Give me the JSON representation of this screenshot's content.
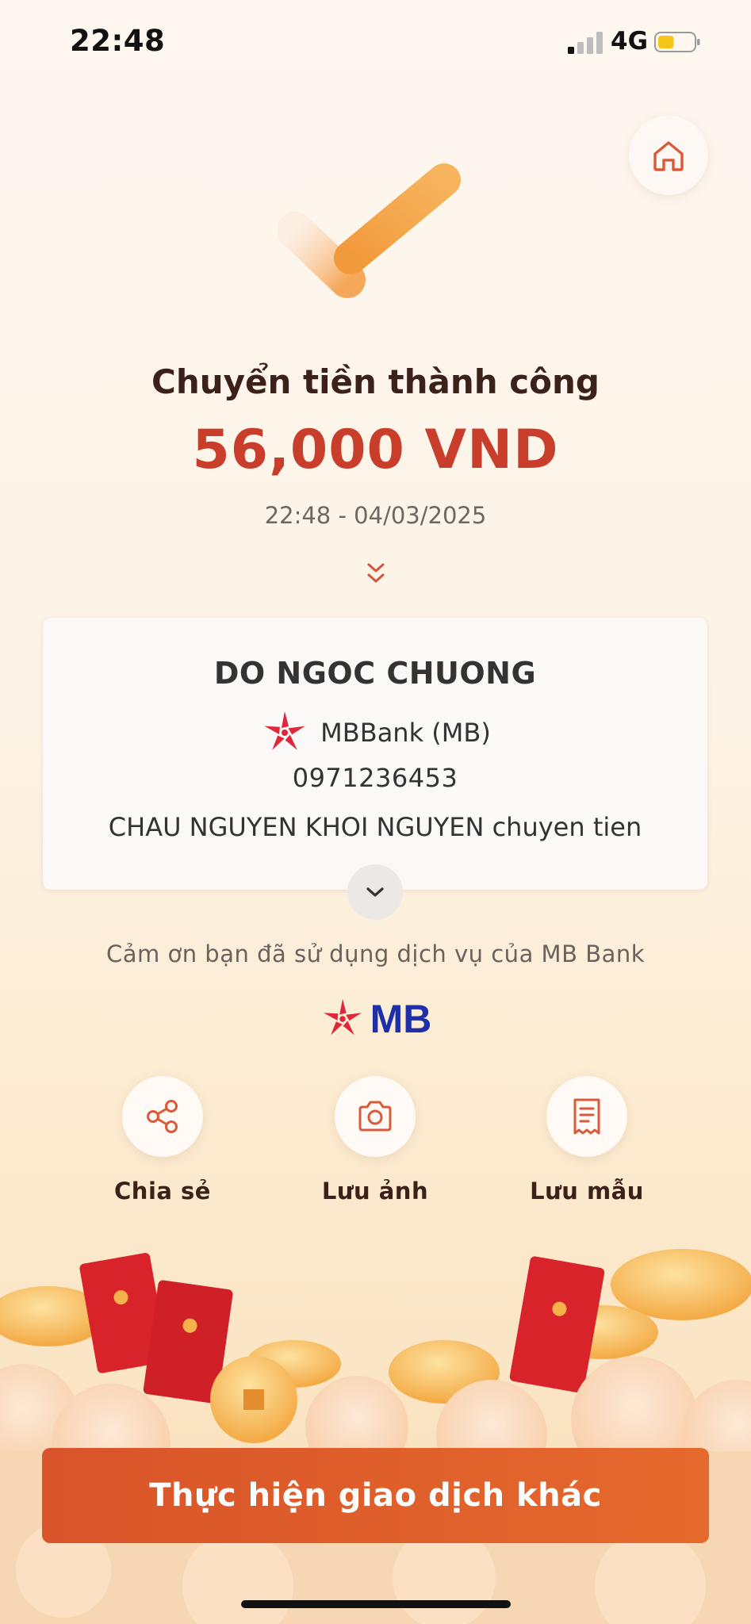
{
  "status_bar": {
    "time": "22:48",
    "network": "4G",
    "battery_level": 0.45,
    "battery_color": "#f5c518",
    "icons": [
      "signal-icon",
      "battery-icon"
    ]
  },
  "header": {
    "home_icon": "home-icon"
  },
  "result": {
    "title": "Chuyển tiền thành công",
    "amount": "56,000 VND",
    "datetime": "22:48 - 04/03/2025",
    "icon": "check-icon"
  },
  "recipient": {
    "name": "DO NGOC CHUONG",
    "bank": "MBBank (MB)",
    "account": "0971236453",
    "message": "CHAU NGUYEN KHOI NGUYEN chuyen tien"
  },
  "footer": {
    "thanks": "Cảm ơn bạn đã sử dụng dịch vụ của MB Bank",
    "logo_text": "MB"
  },
  "actions": [
    {
      "label": "Chia sẻ",
      "icon": "share-icon"
    },
    {
      "label": "Lưu ảnh",
      "icon": "camera-icon"
    },
    {
      "label": "Lưu mẫu",
      "icon": "receipt-icon"
    }
  ],
  "cta": {
    "label": "Thực hiện giao dịch khác"
  },
  "colors": {
    "accent": "#e05f2b",
    "amount": "#c93d2b",
    "brand_blue": "#1f2fa8",
    "brand_red": "#e0263b"
  }
}
